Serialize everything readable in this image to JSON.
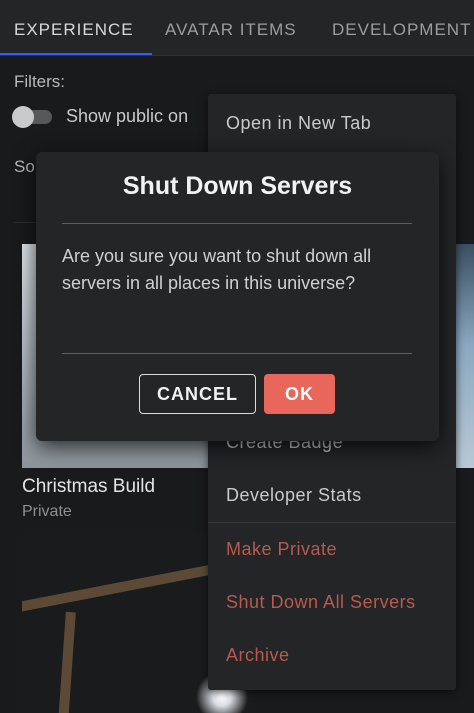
{
  "tabs": [
    {
      "label": "EXPERIENCE",
      "active": true
    },
    {
      "label": "AVATAR ITEMS",
      "active": false
    },
    {
      "label": "DEVELOPMENT",
      "active": false
    }
  ],
  "filters": {
    "label": "Filters:",
    "toggle_label": "Show public on",
    "toggle_on": false,
    "sort_label": "So"
  },
  "cards": [
    {
      "title": "Christmas Build",
      "status": "Private"
    }
  ],
  "context_menu": {
    "items": [
      {
        "label": "Open in New Tab",
        "danger": false
      },
      {
        "label": "Create Badge",
        "danger": false
      },
      {
        "label": "Developer Stats",
        "danger": false
      },
      {
        "label": "Make Private",
        "danger": true
      },
      {
        "label": "Shut Down All Servers",
        "danger": true
      },
      {
        "label": "Archive",
        "danger": true
      }
    ]
  },
  "modal": {
    "title": "Shut Down Servers",
    "body": "Are you sure you want to shut down all servers in all places in this universe?",
    "cancel_label": "CANCEL",
    "ok_label": "OK"
  },
  "colors": {
    "background": "#191a1b",
    "accent": "#335fff",
    "danger": "#b85a4f",
    "ok_button": "#e8675a"
  }
}
